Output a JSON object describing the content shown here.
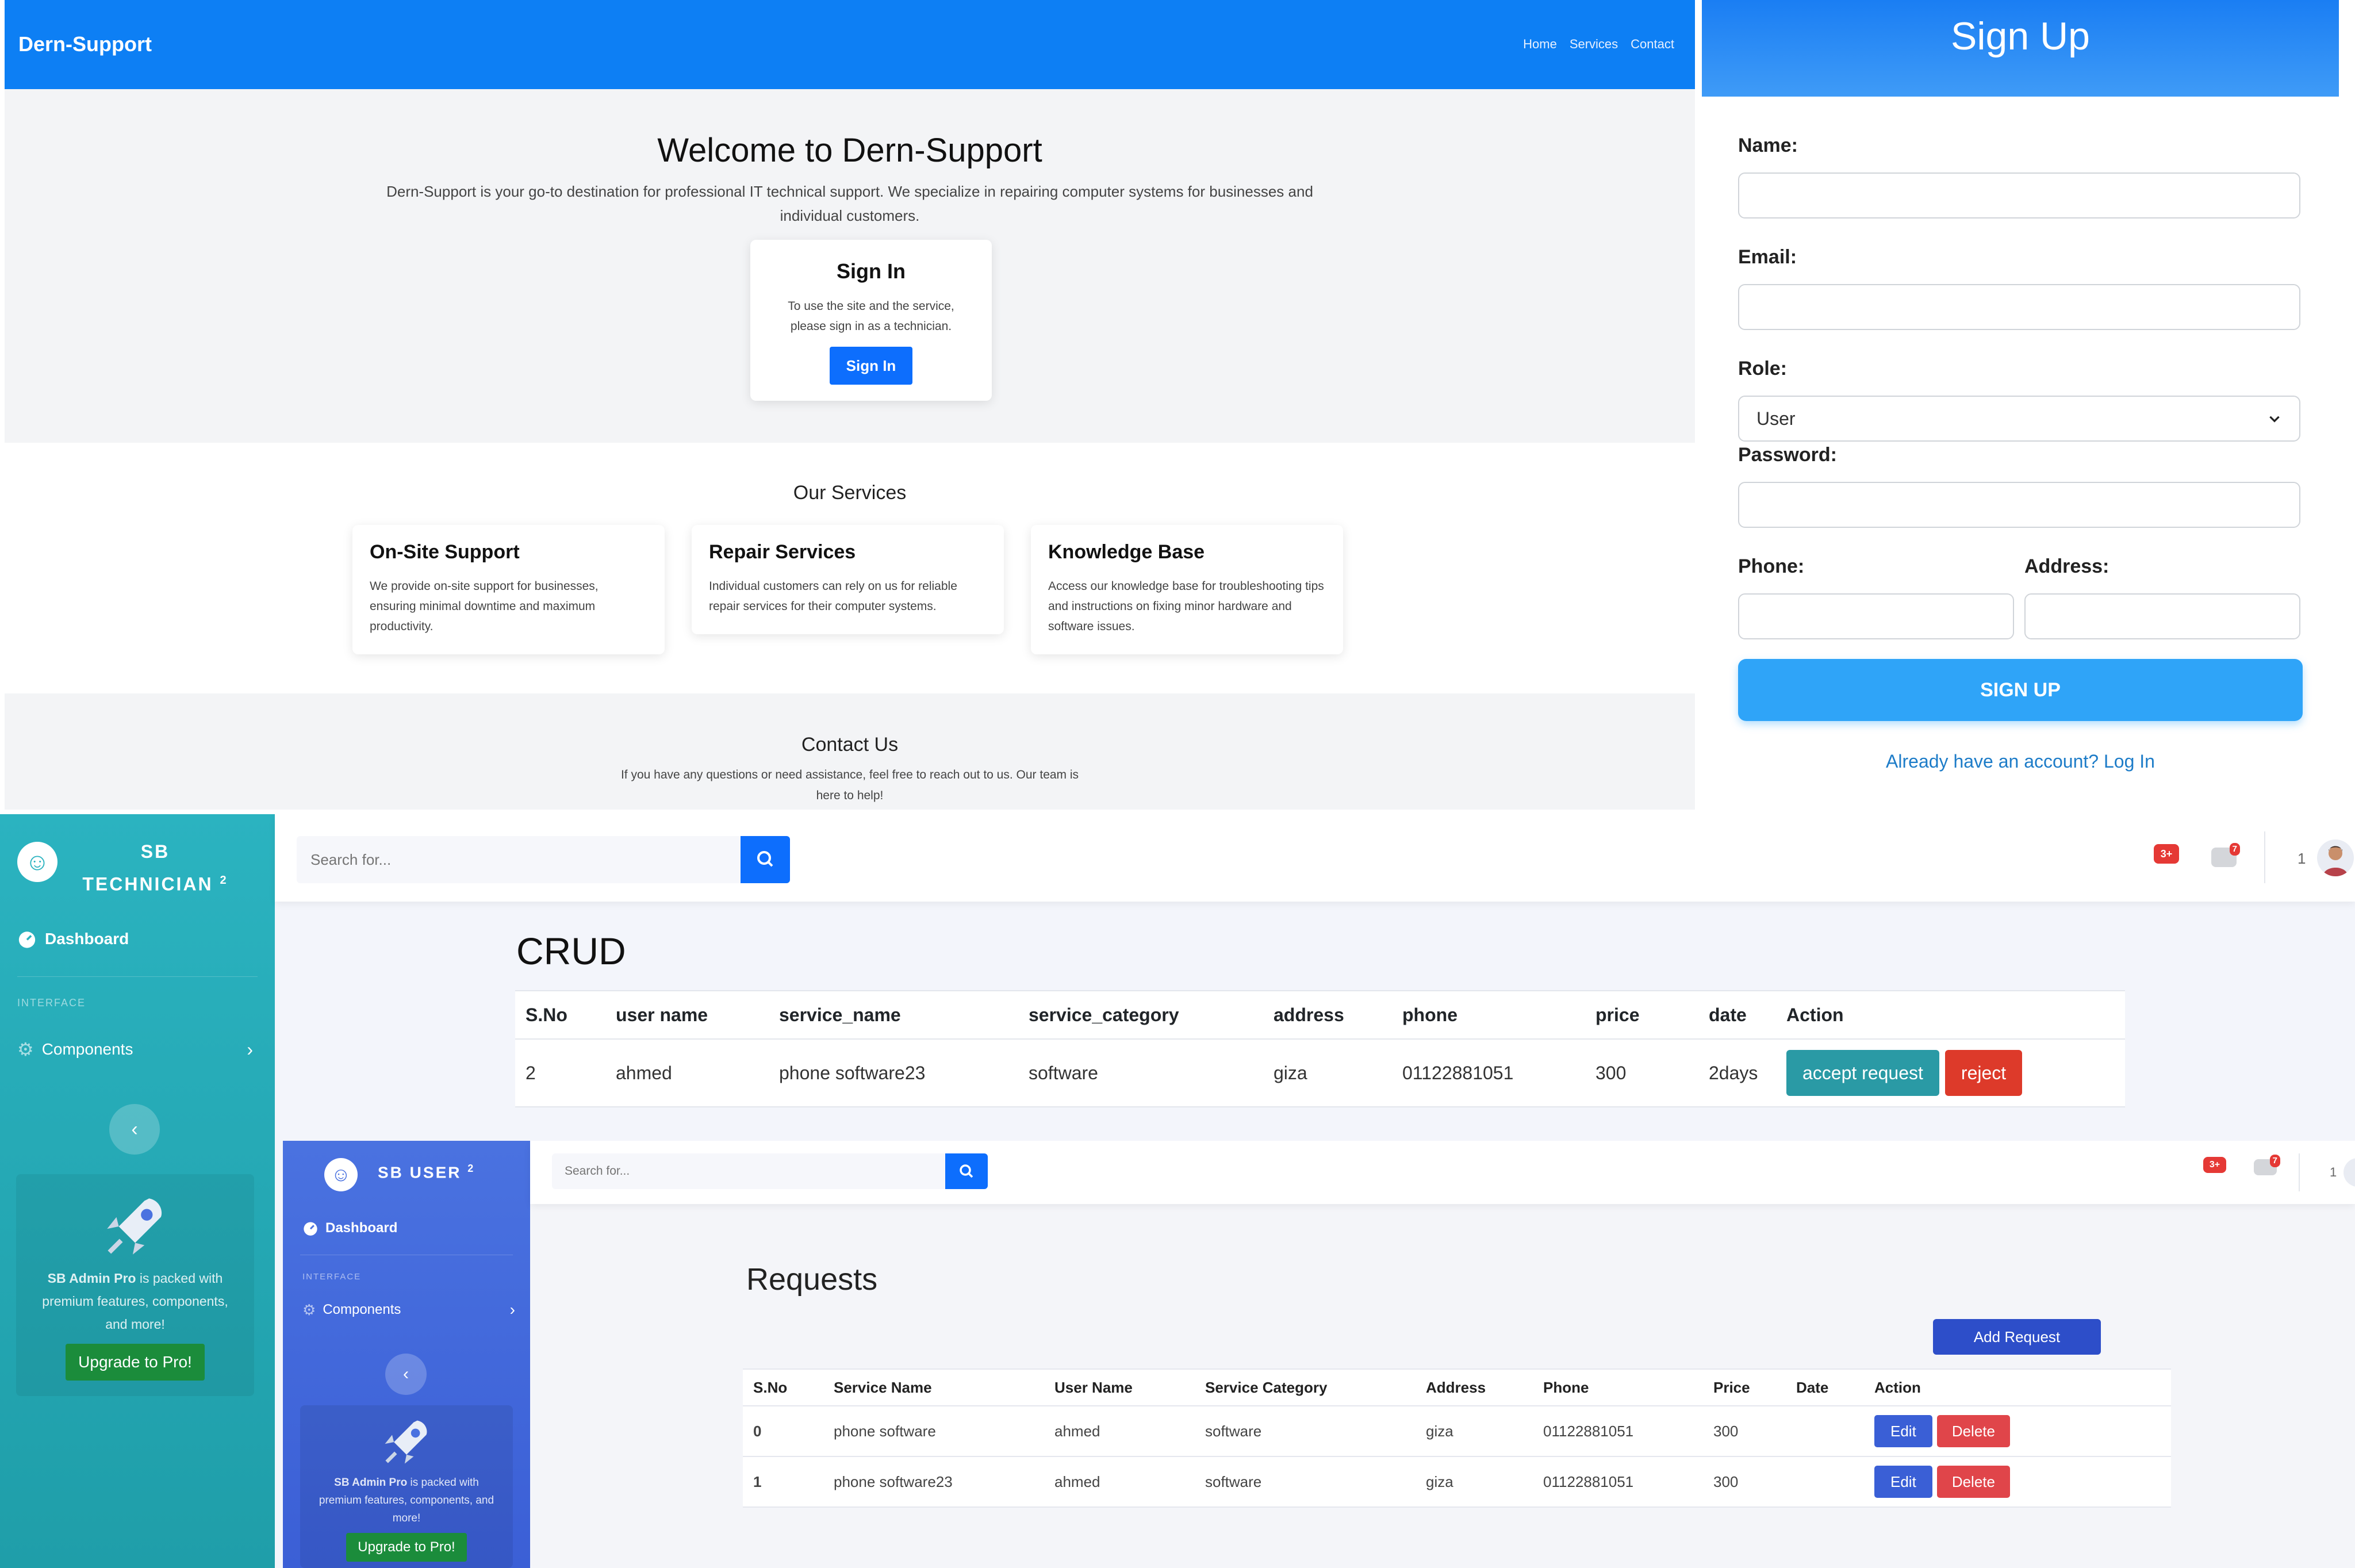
{
  "landing": {
    "brand": "Dern-Support",
    "nav": [
      "Home",
      "Services",
      "Contact"
    ],
    "hero_title": "Welcome to Dern-Support",
    "hero_desc": "Dern-Support is your go-to destination for professional IT technical support. We specialize in repairing computer systems for businesses and individual customers.",
    "signin_card": {
      "title": "Sign In",
      "desc": "To use the site and the service, please sign in as a technician.",
      "button": "Sign In"
    },
    "services_title": "Our Services",
    "services": [
      {
        "title": "On-Site Support",
        "desc": "We provide on-site support for businesses, ensuring minimal downtime and maximum productivity."
      },
      {
        "title": "Repair Services",
        "desc": "Individual customers can rely on us for reliable repair services for their computer systems."
      },
      {
        "title": "Knowledge Base",
        "desc": "Access our knowledge base for troubleshooting tips and instructions on fixing minor hardware and software issues."
      }
    ],
    "contact_title": "Contact Us",
    "contact_desc": "If you have any questions or need assistance, feel free to reach out to us. Our team is here to help!"
  },
  "signup": {
    "title": "Sign Up",
    "name_label": "Name:",
    "email_label": "Email:",
    "role_label": "Role:",
    "role_value": "User",
    "password_label": "Password:",
    "phone_label": "Phone:",
    "address_label": "Address:",
    "button": "SIGN UP",
    "login_link": "Already have an account? Log In"
  },
  "technician": {
    "brand_top": "SB",
    "brand_bottom": "TECHNICIAN",
    "brand_sup": "2",
    "nav_dashboard": "Dashboard",
    "nav_heading": "INTERFACE",
    "nav_components": "Components",
    "promo_brand": "SB Admin Pro",
    "promo_text": " is packed with premium features, components, and more!",
    "promo_button": "Upgrade to Pro!",
    "search_placeholder": "Search for...",
    "alerts_badge": "3+",
    "messages_badge": "7",
    "user_count": "1",
    "page_title": "CRUD",
    "columns": [
      "S.No",
      "user name",
      "service_name",
      "service_category",
      "address",
      "phone",
      "price",
      "date",
      "Action"
    ],
    "rows": [
      {
        "sno": "2",
        "user": "ahmed",
        "service": "phone software23",
        "category": "software",
        "address": "giza",
        "phone": "01122881051",
        "price": "300",
        "date": "2days"
      }
    ],
    "accept_label": "accept request",
    "reject_label": "reject"
  },
  "user": {
    "brand": "SB USER",
    "brand_sup": "2",
    "nav_dashboard": "Dashboard",
    "nav_heading": "INTERFACE",
    "nav_components": "Components",
    "promo_brand": "SB Admin Pro",
    "promo_text": " is packed with premium features, components, and more!",
    "promo_button": "Upgrade to Pro!",
    "search_placeholder": "Search for...",
    "alerts_badge": "3+",
    "messages_badge": "7",
    "user_count": "1",
    "page_title": "Requests",
    "add_button": "Add Request",
    "columns": [
      "S.No",
      "Service Name",
      "User Name",
      "Service Category",
      "Address",
      "Phone",
      "Price",
      "Date",
      "Action"
    ],
    "rows": [
      {
        "sno": "0",
        "service": "phone software",
        "user": "ahmed",
        "category": "software",
        "address": "giza",
        "phone": "01122881051",
        "price": "300",
        "date": ""
      },
      {
        "sno": "1",
        "service": "phone software23",
        "user": "ahmed",
        "category": "software",
        "address": "giza",
        "phone": "01122881051",
        "price": "300",
        "date": ""
      }
    ],
    "edit_label": "Edit",
    "delete_label": "Delete"
  },
  "colors": {
    "landing_nav": "#0d7ff4",
    "signup_button": "#2fa4f8",
    "technician_sidebar": "#2bb3c0",
    "user_sidebar": "#4a72e0",
    "accept": "#2a9aa5",
    "reject": "#dd3a2a",
    "edit": "#3a5fd6",
    "delete": "#e0454a",
    "upgrade": "#1b8c3b"
  },
  "icons": [
    "laugh-wink-icon",
    "tachometer-icon",
    "cog-icon",
    "chevron-right-icon",
    "chevron-left-icon",
    "rocket-icon",
    "search-icon",
    "bell-icon",
    "envelope-icon",
    "avatar",
    "chevron-down-icon"
  ]
}
